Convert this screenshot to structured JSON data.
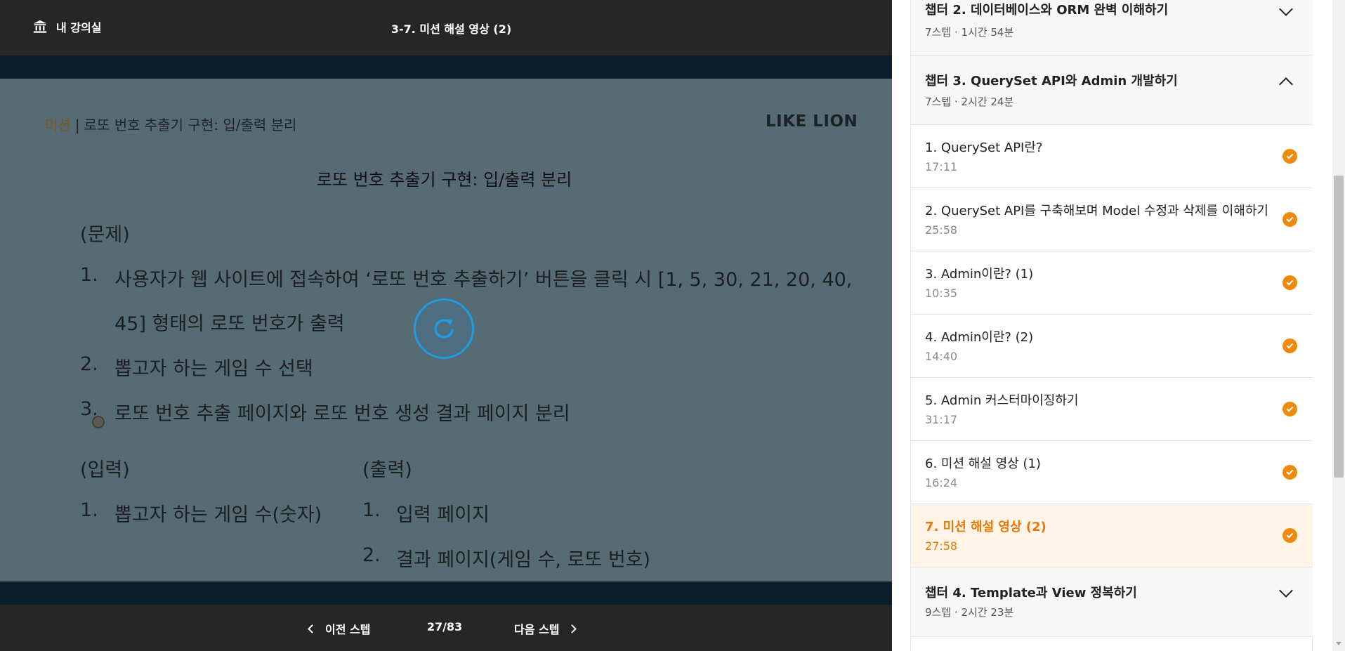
{
  "topbar": {
    "home_label": "내 강의실",
    "home_icon": "bank-icon",
    "lesson_title": "3-7. 미션 해설 영상 (2)"
  },
  "slide": {
    "tag": "미션",
    "separator": "|",
    "header_text": "로또 번호 추출기 구현: 입/출력 분리",
    "brand": "LIKE LION",
    "heading": "로또 번호 추출기 구현: 입/출력 분리",
    "problem_label": "(문제)",
    "problem_items": [
      {
        "num": "1.",
        "line1": "사용자가 웹 사이트에 접속하여 ‘로또 번호 추출하기’ 버튼을 클릭 시 [1, 5, 30, 21, 20, 40,",
        "line2": "45] 형태의 로또 번호가 출력"
      },
      {
        "num": "2.",
        "line1": "뽑고자 하는 게임 수 선택"
      },
      {
        "num": "3.",
        "line1": "로또 번호 추출 페이지와 로또 번호 생성 결과 페이지 분리"
      }
    ],
    "input_label": "(입력)",
    "input_items": [
      {
        "num": "1.",
        "text": "뽑고자 하는 게임 수(숫자)"
      }
    ],
    "output_label": "(출력)",
    "output_items": [
      {
        "num": "1.",
        "text": "입력 페이지"
      },
      {
        "num": "2.",
        "text": "결과 페이지(게임 수, 로또 번호)"
      }
    ]
  },
  "player": {
    "spinner_icon": "reload-icon",
    "prev_label": "이전 스텝",
    "progress": "27/83",
    "next_label": "다음 스텝"
  },
  "colors": {
    "accent": "#f08a0c",
    "active_bg": "#fff4e6",
    "spinner": "#1e9be0"
  },
  "curriculum": {
    "chapters": [
      {
        "title": "챕터 2. 데이터베이스와 ORM 완벽 이해하기",
        "meta": "7스텝 · 1시간 54분",
        "expanded": false
      },
      {
        "title": "챕터 3. QuerySet API와 Admin 개발하기",
        "meta": "7스텝 · 2시간 24분",
        "expanded": true
      },
      {
        "title": "챕터 4. Template과 View 정복하기",
        "meta": "9스텝 · 2시간 23분",
        "expanded": false
      }
    ],
    "items": [
      {
        "title": "1. QuerySet API란?",
        "time": "17:11",
        "done": true
      },
      {
        "title": "2. QuerySet API를 구축해보며 Model 수정과 삭제를 이해하기",
        "time": "25:58",
        "done": true
      },
      {
        "title": "3. Admin이란? (1)",
        "time": "10:35",
        "done": true
      },
      {
        "title": "4. Admin이란? (2)",
        "time": "14:40",
        "done": true
      },
      {
        "title": "5. Admin 커스터마이징하기",
        "time": "31:17",
        "done": true
      },
      {
        "title": "6. 미션 해설 영상 (1)",
        "time": "16:24",
        "done": true
      },
      {
        "title": "7. 미션 해설 영상 (2)",
        "time": "27:58",
        "done": true,
        "active": true
      }
    ]
  }
}
